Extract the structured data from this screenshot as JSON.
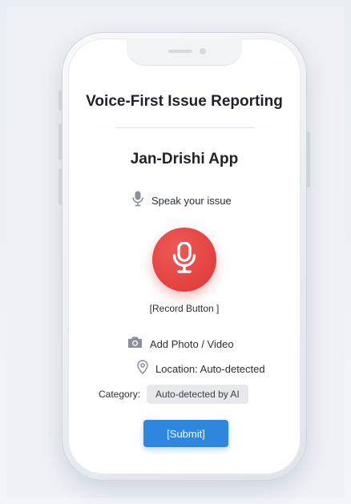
{
  "screen": {
    "title": "Voice-First Issue Reporting",
    "app_name": "Jan-Drishi App"
  },
  "voice": {
    "prompt": "Speak your issue",
    "prompt_icon": "microphone-icon",
    "record_icon": "microphone-icon",
    "record_caption": "[Record Button ]"
  },
  "media": {
    "label": "Add Photo / Video",
    "icon": "camera-icon"
  },
  "location": {
    "label": "Location: Auto-detected",
    "icon": "location-pin-icon"
  },
  "category": {
    "label": "Category:",
    "value": "Auto-detected by AI"
  },
  "submit": {
    "label": "[Submit]"
  },
  "colors": {
    "record_button": "#e2413f",
    "submit_button": "#2f86de",
    "background": "#eef2f7"
  }
}
